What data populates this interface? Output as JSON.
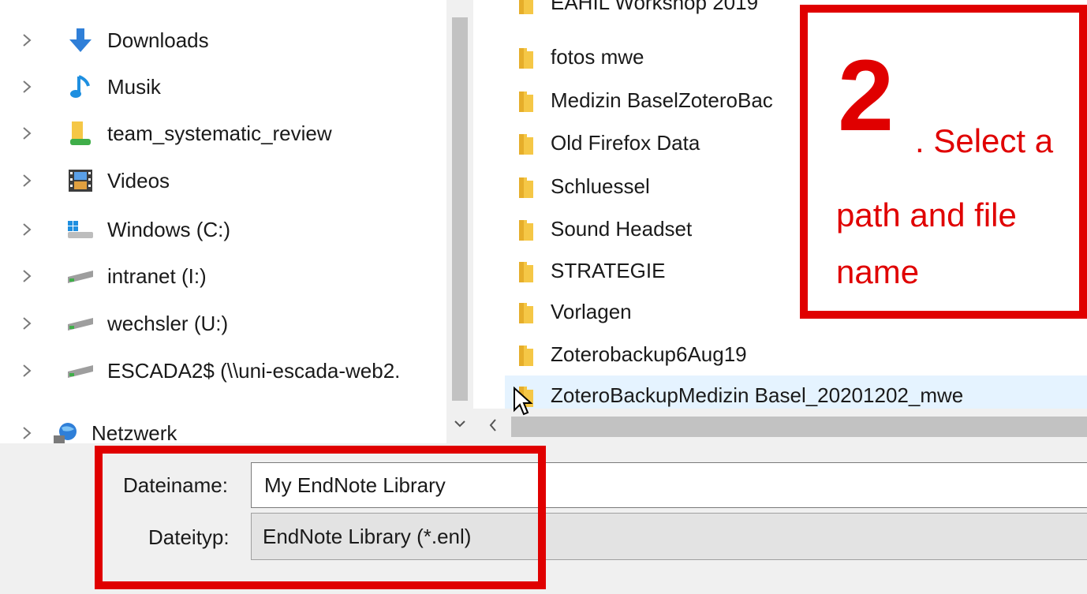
{
  "navigation": {
    "items": [
      {
        "label": "Downloads",
        "icon": "downloads-arrow-icon"
      },
      {
        "label": "Musik",
        "icon": "music-note-icon"
      },
      {
        "label": "team_systematic_review",
        "icon": "shared-folder-icon"
      },
      {
        "label": "Videos",
        "icon": "video-film-icon"
      },
      {
        "label": "Windows (C:)",
        "icon": "windows-drive-icon"
      },
      {
        "label": "intranet (I:)",
        "icon": "network-drive-icon"
      },
      {
        "label": "wechsler (U:)",
        "icon": "network-drive-icon"
      },
      {
        "label": "ESCADA2$ (\\\\uni-escada-web2.",
        "icon": "network-drive-icon"
      },
      {
        "label": "Netzwerk",
        "icon": "network-globe-icon"
      }
    ]
  },
  "file_list": {
    "top_partial": "EAHIL Workshop 2019",
    "items": [
      {
        "label": "fotos mwe"
      },
      {
        "label": "Medizin BaselZoteroBac"
      },
      {
        "label": "Old Firefox Data"
      },
      {
        "label": "Schluessel"
      },
      {
        "label": "Sound Headset"
      },
      {
        "label": "STRATEGIE"
      },
      {
        "label": "Vorlagen"
      },
      {
        "label": "Zoterobackup6Aug19"
      },
      {
        "label": "ZoteroBackupMedizin Basel_20201202_mwe"
      }
    ],
    "selected_index": 8
  },
  "save_form": {
    "filename_label": "Dateiname:",
    "filename_value": "My EndNote Library",
    "filetype_label": "Dateityp:",
    "filetype_value": "EndNote Library (*.enl)"
  },
  "annotation": {
    "number": "2",
    "line1": ". Select a",
    "line2": "path and file",
    "line3": "name"
  },
  "colors": {
    "annotation_red": "#e00000",
    "selection_bg": "#e5f3ff",
    "folder_yellow": "#f5c746"
  }
}
